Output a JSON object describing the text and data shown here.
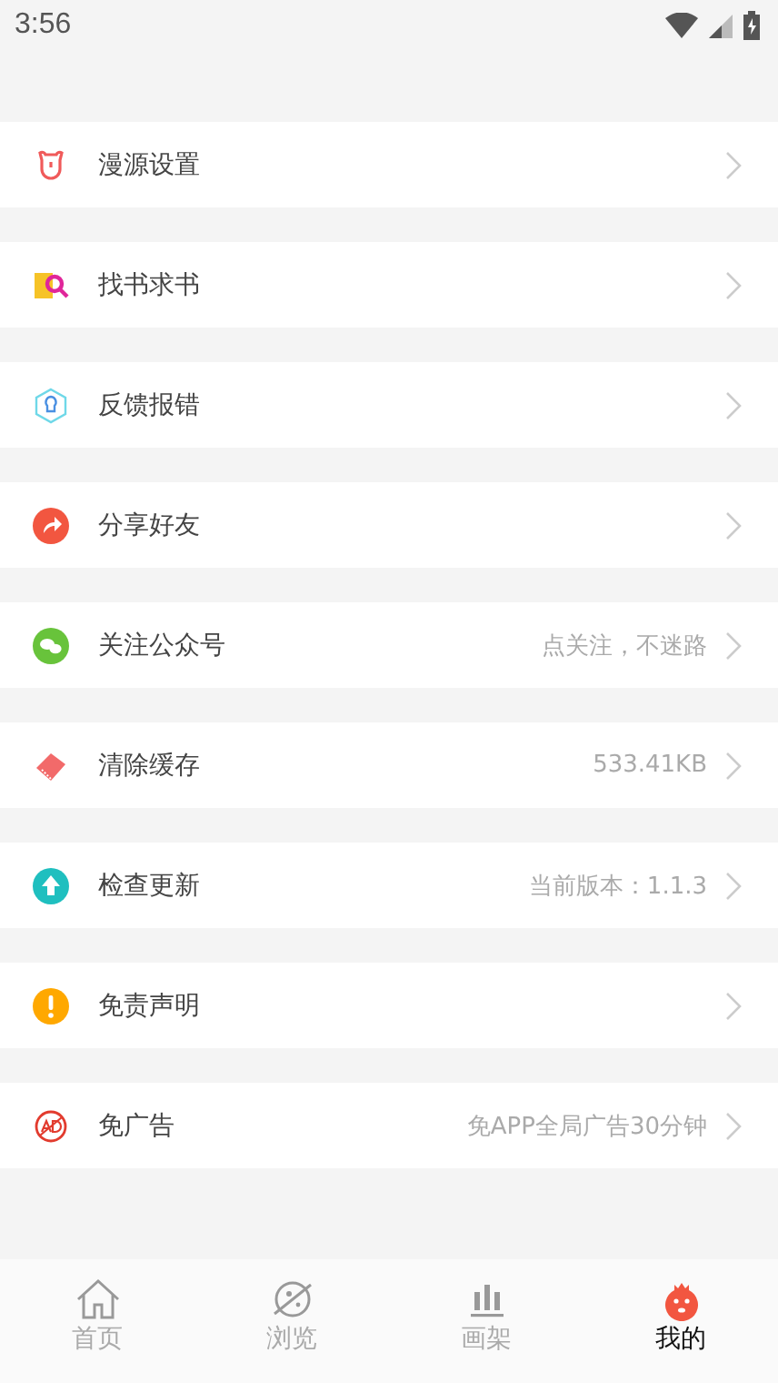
{
  "status_bar": {
    "time": "3:56"
  },
  "menu": [
    {
      "kind": "bear",
      "label": "漫源设置"
    },
    {
      "kind": "search-book",
      "label": "找书求书"
    },
    {
      "kind": "bulb",
      "label": "反馈报错"
    },
    {
      "kind": "share",
      "label": "分享好友"
    },
    {
      "kind": "chat",
      "label": "关注公众号",
      "value": "点关注，不迷路"
    },
    {
      "kind": "eraser",
      "label": "清除缓存",
      "value": "533.41KB"
    },
    {
      "kind": "upload",
      "label": "检查更新",
      "value": "当前版本：1.1.3"
    },
    {
      "kind": "alert",
      "label": "免责声明"
    },
    {
      "kind": "no-ad",
      "label": "免广告",
      "value": "免APP全局广告30分钟"
    }
  ],
  "bottom_nav": [
    {
      "kind": "home",
      "label": "首页",
      "selected": false
    },
    {
      "kind": "planet",
      "label": "浏览",
      "selected": false
    },
    {
      "kind": "shelf",
      "label": "画架",
      "selected": false
    },
    {
      "kind": "mascot",
      "label": "我的",
      "selected": true
    }
  ]
}
